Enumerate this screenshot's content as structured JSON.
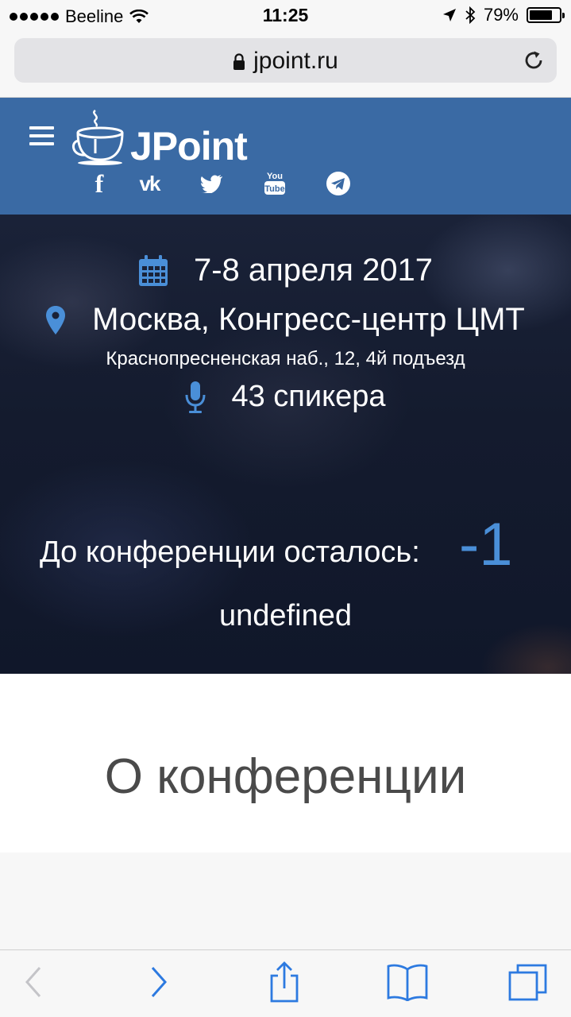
{
  "status_bar": {
    "carrier": "Beeline",
    "time": "11:25",
    "battery_percent": "79%",
    "battery_level": 0.79
  },
  "address_bar": {
    "url": "jpoint.ru"
  },
  "header": {
    "logo_text": "JPoint",
    "socials": [
      "facebook",
      "vk",
      "twitter",
      "youtube",
      "telegram"
    ]
  },
  "hero": {
    "date": "7-8 апреля 2017",
    "city": "Москва, Конгресс-центр ЦМТ",
    "address": "Краснопресненская наб., 12, 4й подъезд",
    "speakers": "43 спикера",
    "countdown_label": "До конференции осталось:",
    "countdown_value": "-1",
    "countdown_unit": "undefined"
  },
  "about": {
    "title": "О конференции"
  },
  "colors": {
    "header_bg": "#3a6aa4",
    "accent": "#4a8fd8",
    "ios_tint": "#2d7ae0"
  }
}
